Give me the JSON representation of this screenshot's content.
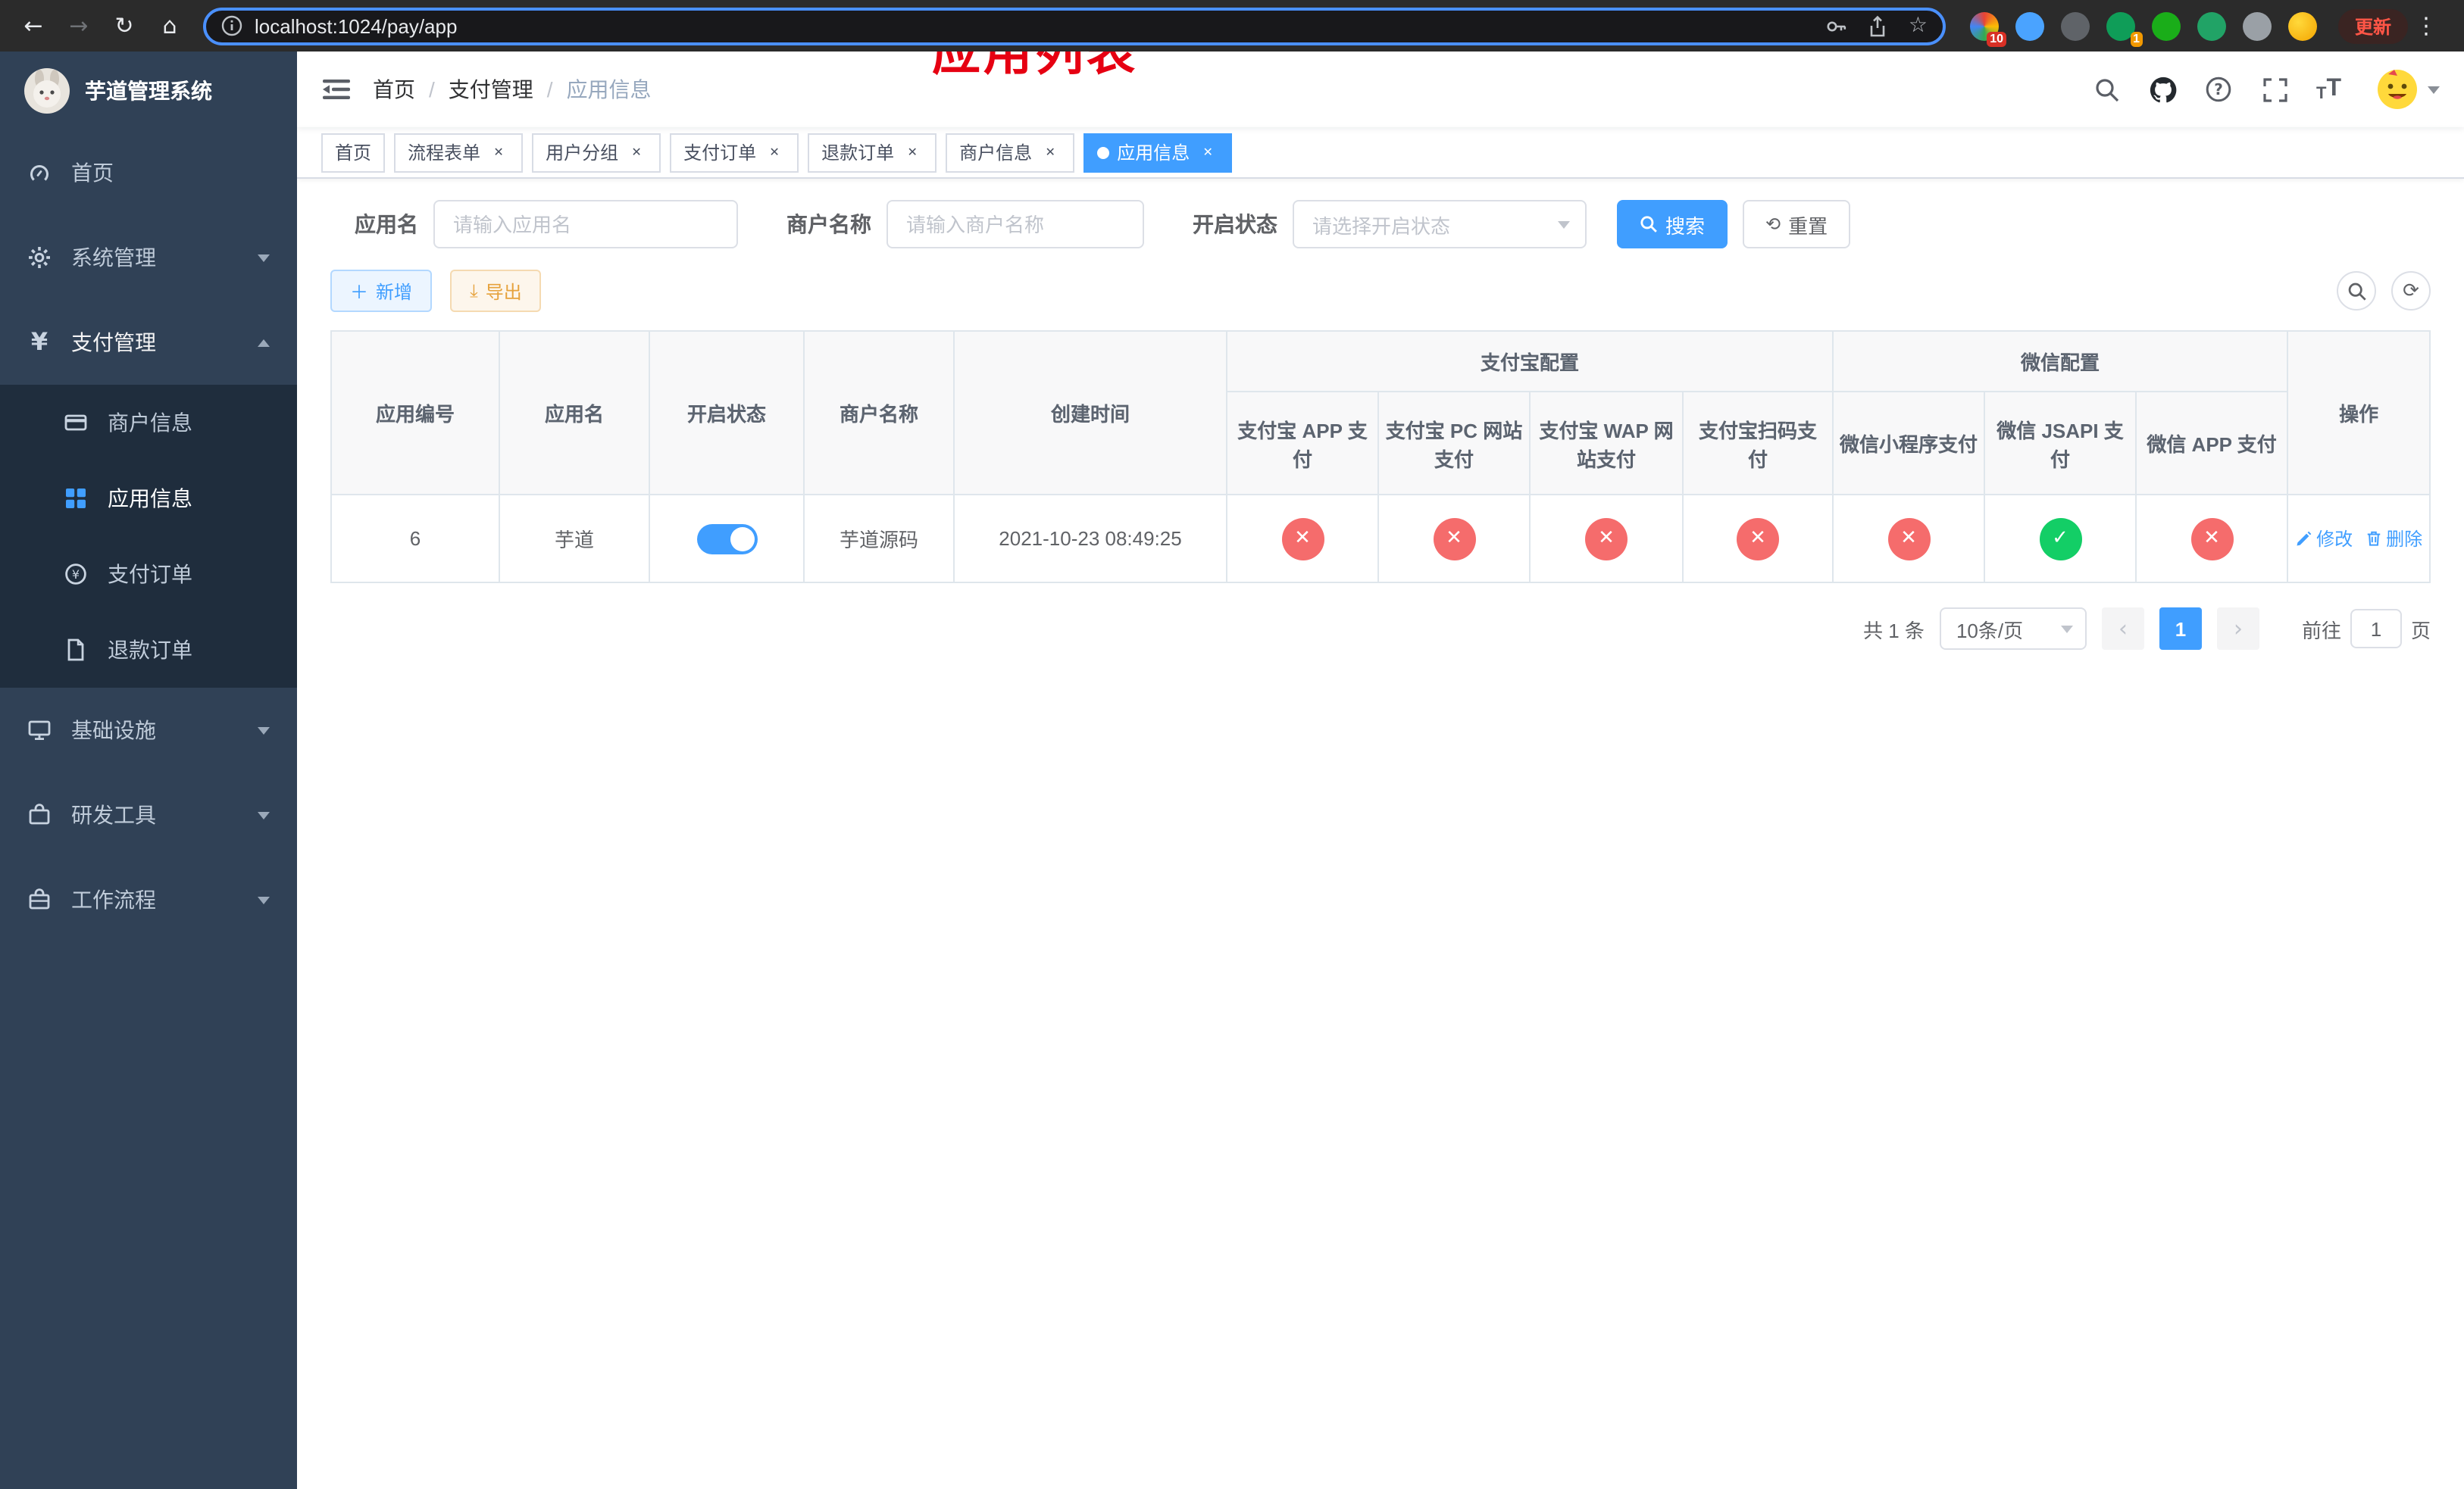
{
  "browser": {
    "url": "localhost:1024/pay/app",
    "update_label": "更新",
    "extension_badge_grid": "10",
    "extension_badge_teal": "1"
  },
  "sidebar": {
    "title": "芋道管理系统",
    "items": [
      {
        "label": "首页"
      },
      {
        "label": "系统管理"
      },
      {
        "label": "支付管理"
      },
      {
        "label": "基础设施"
      },
      {
        "label": "研发工具"
      },
      {
        "label": "工作流程"
      }
    ],
    "payment_submenu": [
      {
        "label": "商户信息"
      },
      {
        "label": "应用信息"
      },
      {
        "label": "支付订单"
      },
      {
        "label": "退款订单"
      }
    ]
  },
  "header": {
    "breadcrumb": [
      "首页",
      "支付管理",
      "应用信息"
    ],
    "annotation": "应用列表"
  },
  "tabs": [
    {
      "label": "首页"
    },
    {
      "label": "流程表单"
    },
    {
      "label": "用户分组"
    },
    {
      "label": "支付订单"
    },
    {
      "label": "退款订单"
    },
    {
      "label": "商户信息"
    },
    {
      "label": "应用信息"
    }
  ],
  "filters": {
    "app_name_label": "应用名",
    "app_name_placeholder": "请输入应用名",
    "merchant_label": "商户名称",
    "merchant_placeholder": "请输入商户名称",
    "status_label": "开启状态",
    "status_placeholder": "请选择开启状态",
    "search_label": "搜索",
    "reset_label": "重置"
  },
  "toolbar": {
    "add_label": "新增",
    "export_label": "导出"
  },
  "table": {
    "headers": {
      "app_id": "应用编号",
      "app_name": "应用名",
      "status": "开启状态",
      "merchant": "商户名称",
      "created": "创建时间",
      "alipay_group": "支付宝配置",
      "wechat_group": "微信配置",
      "alipay_app": "支付宝 APP 支付",
      "alipay_pc": "支付宝 PC 网站支付",
      "alipay_wap": "支付宝 WAP 网站支付",
      "alipay_qr": "支付宝扫码支付",
      "wx_mini": "微信小程序支付",
      "wx_jsapi": "微信 JSAPI 支付",
      "wx_app": "微信 APP 支付",
      "actions": "操作"
    },
    "rows": [
      {
        "app_id": "6",
        "app_name": "芋道",
        "status_enabled": true,
        "merchant": "芋道源码",
        "created": "2021-10-23 08:49:25",
        "alipay_app": false,
        "alipay_pc": false,
        "alipay_wap": false,
        "alipay_qr": false,
        "wx_mini": false,
        "wx_jsapi": true,
        "wx_app": false,
        "edit_label": "修改",
        "delete_label": "删除"
      }
    ]
  },
  "pagination": {
    "total": "共 1 条",
    "page_size": "10条/页",
    "current_page": "1",
    "goto_label": "前往",
    "goto_value": "1",
    "page_label": "页"
  },
  "colors": {
    "accent": "#409eff",
    "success": "#13ce66",
    "danger": "#f56c6c",
    "sidebar": "#304156",
    "annotation": "#e60012"
  }
}
